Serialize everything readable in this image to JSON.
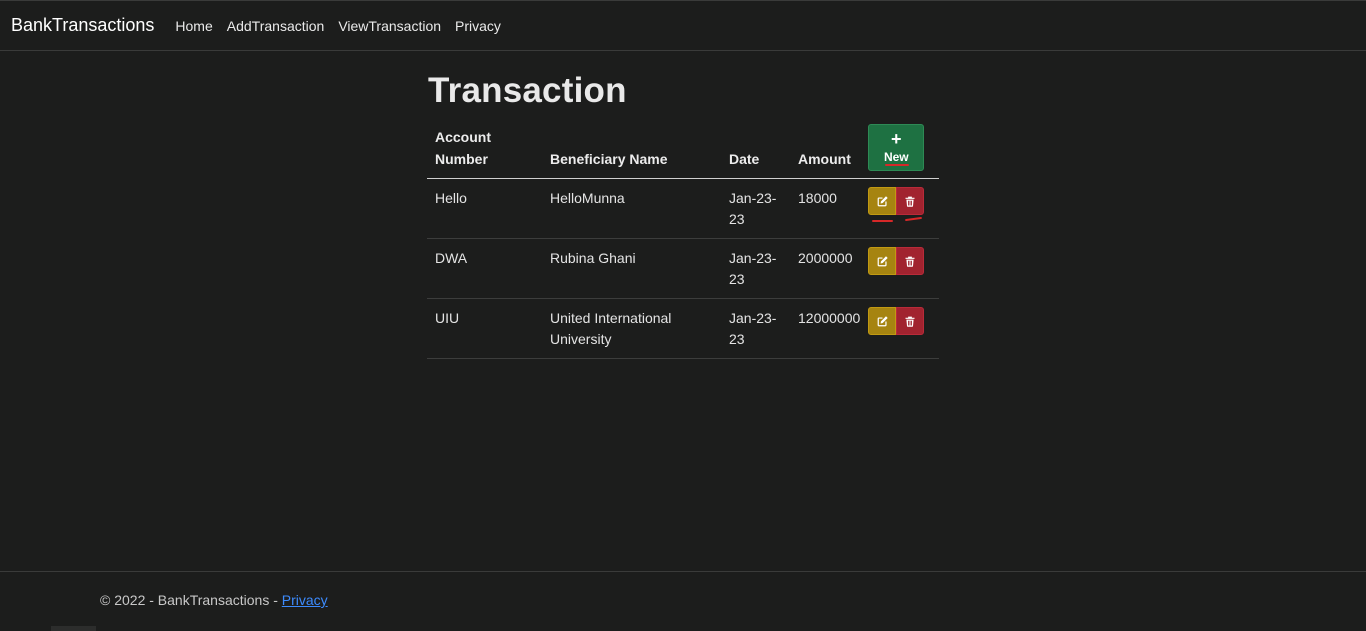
{
  "navbar": {
    "brand": "BankTransactions",
    "links": [
      "Home",
      "AddTransaction",
      "ViewTransaction",
      "Privacy"
    ]
  },
  "page": {
    "title": "Transaction"
  },
  "table": {
    "headers": {
      "account_number": "Account Number",
      "beneficiary_name": "Beneficiary Name",
      "date": "Date",
      "amount": "Amount"
    },
    "new_button": {
      "icon": "plus-icon",
      "label": "New"
    },
    "rows": [
      {
        "account_number": "Hello",
        "beneficiary_name": "HelloMunna",
        "date": "Jan-23-23",
        "amount": "18000"
      },
      {
        "account_number": "DWA",
        "beneficiary_name": "Rubina Ghani",
        "date": "Jan-23-23",
        "amount": "2000000"
      },
      {
        "account_number": "UIU",
        "beneficiary_name": "United International University",
        "date": "Jan-23-23",
        "amount": "12000000"
      }
    ],
    "row_actions": {
      "edit_icon": "edit-icon",
      "delete_icon": "trash-icon"
    }
  },
  "footer": {
    "text": "© 2022 - BankTransactions - ",
    "link": "Privacy"
  },
  "colors": {
    "background": "#1c1d1c",
    "new_button": "#1e7142",
    "edit_button": "#a68410",
    "delete_button": "#a1232f",
    "annotation": "#d62828",
    "footer_link": "#3d8bfd"
  }
}
